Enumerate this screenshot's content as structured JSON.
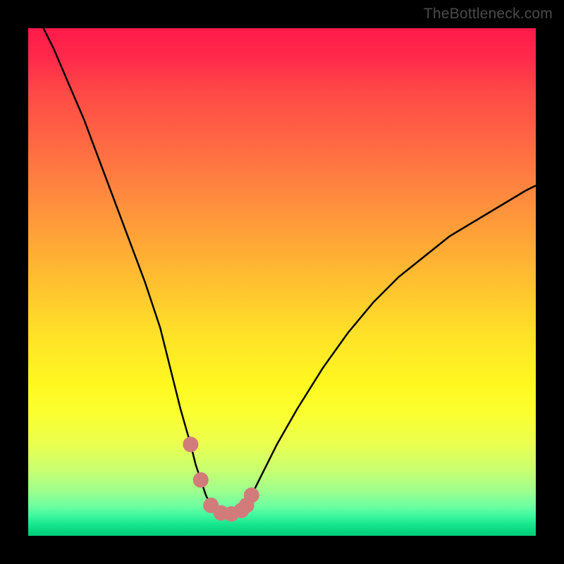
{
  "watermark": "TheBottleneck.com",
  "chart_data": {
    "type": "line",
    "title": "",
    "xlabel": "",
    "ylabel": "",
    "xlim": [
      0,
      100
    ],
    "ylim": [
      0,
      100
    ],
    "series": [
      {
        "name": "bottleneck-curve",
        "x": [
          3,
          5,
          8,
          11,
          14,
          17,
          20,
          23,
          26,
          28,
          30,
          32,
          33,
          34,
          35,
          36,
          37,
          38,
          39,
          40,
          41,
          42,
          43,
          44,
          46,
          49,
          53,
          58,
          63,
          68,
          73,
          78,
          83,
          88,
          93,
          98,
          100
        ],
        "y": [
          100,
          96,
          89,
          82,
          74,
          66,
          58,
          50,
          41,
          33,
          25,
          18,
          14,
          11,
          8,
          6,
          5,
          4.5,
          4.3,
          4.3,
          4.5,
          5,
          6,
          8,
          12,
          18,
          25,
          33,
          40,
          46,
          51,
          55,
          59,
          62,
          65,
          68,
          69
        ]
      },
      {
        "name": "marker-dots",
        "x": [
          32,
          34,
          36,
          38,
          40,
          42,
          43,
          44
        ],
        "y": [
          18,
          11,
          6,
          4.5,
          4.3,
          5,
          6,
          8
        ]
      }
    ],
    "marker_color": "#d27b7b",
    "line_color": "#000000"
  }
}
